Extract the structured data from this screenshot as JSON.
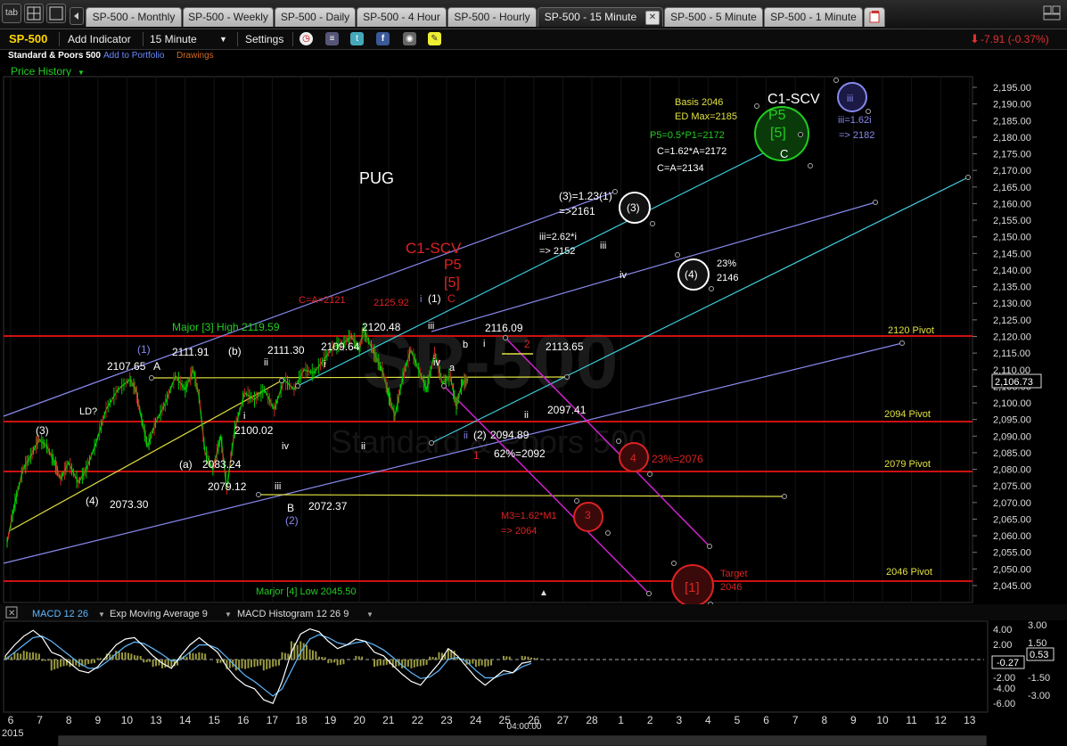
{
  "tabs": [
    {
      "label": "SP-500 - Monthly",
      "active": false
    },
    {
      "label": "SP-500 - Weekly",
      "active": false
    },
    {
      "label": "SP-500 - Daily",
      "active": false
    },
    {
      "label": "SP-500 - 4 Hour",
      "active": false
    },
    {
      "label": "SP-500 - Hourly",
      "active": false
    },
    {
      "label": "SP-500 - 15 Minute",
      "active": true
    },
    {
      "label": "SP-500 - 5 Minute",
      "active": false
    },
    {
      "label": "SP-500 - 1 Minute",
      "active": false
    }
  ],
  "tab_icon_label": "tab",
  "toolbar": {
    "symbol": "SP-500",
    "add_indicator": "Add Indicator",
    "interval": "15 Minute",
    "settings": "Settings",
    "change": "-7.91 (-0.37%)"
  },
  "subheader": {
    "name": "Standard & Poors 500",
    "add_to_portfolio": "Add to Portfolio",
    "drawings": "Drawings",
    "price_history": "Price History"
  },
  "colors": {
    "up": "#00cc00",
    "down": "#cc2222",
    "cyan_line": "#40d0e0",
    "purple_line": "#8888ee",
    "pivot_line": "#cc1111",
    "yellow_line": "#e0e040",
    "magenta_line": "#cc22cc"
  },
  "chart_data": [
    {
      "type": "candlestick",
      "symbol": "SP-500",
      "watermark": "SP-500",
      "watermark_sub": "Standard & Poors 500",
      "ylim": [
        2040,
        2200
      ],
      "y_ticks": [
        "2,195.00",
        "2,190.00",
        "2,185.00",
        "2,180.00",
        "2,175.00",
        "2,170.00",
        "2,165.00",
        "2,160.00",
        "2,155.00",
        "2,150.00",
        "2,145.00",
        "2,140.00",
        "2,135.00",
        "2,130.00",
        "2,125.00",
        "2,120.00",
        "2,115.00",
        "2,110.00",
        "2,105.00",
        "2,100.00",
        "2,095.00",
        "2,090.00",
        "2,085.00",
        "2,080.00",
        "2,075.00",
        "2,070.00",
        "2,065.00",
        "2,060.00",
        "2,055.00",
        "2,050.00",
        "2,045.00"
      ],
      "last_price": "2,106.73",
      "x_ticks": [
        "6",
        "7",
        "8",
        "9",
        "10",
        "13",
        "14",
        "15",
        "16",
        "17",
        "18",
        "19",
        "20",
        "21",
        "22",
        "23",
        "24",
        "25",
        "26",
        "27",
        "28",
        "1",
        "2",
        "3",
        "4",
        "5",
        "6",
        "7",
        "8",
        "9",
        "10",
        "11",
        "12",
        "13",
        "14",
        "15",
        "16",
        "17",
        "18",
        "19",
        "20",
        "21"
      ],
      "year_label": "2015",
      "time_label": "04:00:00",
      "price_path": [
        [
          0,
          2058
        ],
        [
          0.4,
          2070
        ],
        [
          0.8,
          2080
        ],
        [
          1.2,
          2084
        ],
        [
          1.6,
          2089
        ],
        [
          2,
          2087
        ],
        [
          2.4,
          2082
        ],
        [
          2.7,
          2077
        ],
        [
          3.1,
          2082
        ],
        [
          3.6,
          2076
        ],
        [
          4.0,
          2080
        ],
        [
          4.5,
          2088
        ],
        [
          5,
          2098
        ],
        [
          5.6,
          2104
        ],
        [
          6.2,
          2107
        ],
        [
          6.5,
          2104
        ],
        [
          6.8,
          2095
        ],
        [
          7.1,
          2087
        ],
        [
          7.5,
          2094
        ],
        [
          8,
          2100
        ],
        [
          8.5,
          2108
        ],
        [
          9,
          2104
        ],
        [
          9.4,
          2110
        ],
        [
          9.7,
          2102
        ],
        [
          10,
          2085
        ],
        [
          10.4,
          2080
        ],
        [
          10.8,
          2090
        ],
        [
          11.1,
          2074
        ],
        [
          11.5,
          2092
        ],
        [
          12,
          2103
        ],
        [
          12.5,
          2101
        ],
        [
          13,
          2104
        ],
        [
          13.5,
          2098
        ],
        [
          14,
          2107
        ],
        [
          14.5,
          2104
        ],
        [
          15,
          2110
        ],
        [
          15.5,
          2109
        ],
        [
          16,
          2113
        ],
        [
          16.5,
          2117
        ],
        [
          17,
          2118
        ],
        [
          17.4,
          2120
        ],
        [
          17.8,
          2116
        ],
        [
          18,
          2122
        ],
        [
          18.4,
          2117
        ],
        [
          18.7,
          2113
        ],
        [
          19,
          2109
        ],
        [
          19.3,
          2102
        ],
        [
          19.6,
          2096
        ],
        [
          20,
          2108
        ],
        [
          20.4,
          2116
        ],
        [
          20.8,
          2110
        ],
        [
          21.2,
          2104
        ],
        [
          21.6,
          2115
        ],
        [
          22.0,
          2106
        ],
        [
          22.4,
          2108
        ],
        [
          22.7,
          2099
        ],
        [
          23.0,
          2106
        ],
        [
          23.3,
          2107
        ]
      ],
      "pivots": [
        {
          "label": "2120 Pivot",
          "value": 2120
        },
        {
          "label": "2094 Pivot",
          "value": 2094
        },
        {
          "label": "2079 Pivot",
          "value": 2079
        },
        {
          "label": "2046 Pivot",
          "value": 2046
        }
      ],
      "annotations": [
        {
          "text": "PUG",
          "color": "#ffffff"
        },
        {
          "text": "C1-SCV",
          "color": "#dd2222"
        },
        {
          "text": "P5",
          "color": "#dd2222"
        },
        {
          "text": "[5]",
          "color": "#dd2222"
        },
        {
          "text": "C1-SCV",
          "color": "#ffffff"
        },
        {
          "text": "P5",
          "color": "#22cc22"
        },
        {
          "text": "[5]",
          "color": "#22cc22"
        },
        {
          "text": "C",
          "color": "#ffffff"
        },
        {
          "text": "Basis 2046",
          "color": "#e0e040"
        },
        {
          "text": "ED Max=2185",
          "color": "#e0e040"
        },
        {
          "text": "P5=0.5*P1=2172",
          "color": "#22cc22"
        },
        {
          "text": "C=1.62*A=2172",
          "color": "#ffffff"
        },
        {
          "text": "C=A=2134",
          "color": "#ffffff"
        },
        {
          "text": "iii",
          "color": "#8888ee"
        },
        {
          "text": "iii=1.62i",
          "color": "#8888ee"
        },
        {
          "text": "=> 2182",
          "color": "#8888ee"
        },
        {
          "text": "(3)=1.23(1)",
          "color": "#ffffff"
        },
        {
          "text": "=>2161",
          "color": "#ffffff"
        },
        {
          "text": "(3)",
          "color": "#ffffff"
        },
        {
          "text": "iii=2.62*i",
          "color": "#ffffff"
        },
        {
          "text": "=> 2152",
          "color": "#ffffff"
        },
        {
          "text": "iii",
          "color": "#ffffff"
        },
        {
          "text": "iv",
          "color": "#ffffff"
        },
        {
          "text": "(4)",
          "color": "#ffffff"
        },
        {
          "text": "23%",
          "color": "#ffffff"
        },
        {
          "text": "2146",
          "color": "#ffffff"
        },
        {
          "text": "C=A=2121",
          "color": "#dd2222"
        },
        {
          "text": "2125.92",
          "color": "#dd2222"
        },
        {
          "text": "i",
          "color": "#8888ee"
        },
        {
          "text": "(1)",
          "color": "#ffffff"
        },
        {
          "text": "C",
          "color": "#dd2222"
        },
        {
          "text": "Major [3] High 2119.59",
          "color": "#22cc22"
        },
        {
          "text": "2120.48",
          "color": "#ffffff"
        },
        {
          "text": "2116.09",
          "color": "#ffffff"
        },
        {
          "text": "2",
          "color": "#dd2222"
        },
        {
          "text": "2113.65",
          "color": "#ffffff"
        },
        {
          "text": "iii",
          "color": "#ffffff"
        },
        {
          "text": "i",
          "color": "#ffffff"
        },
        {
          "text": "b",
          "color": "#ffffff"
        },
        {
          "text": "iv",
          "color": "#ffffff"
        },
        {
          "text": "a",
          "color": "#ffffff"
        },
        {
          "text": "ii",
          "color": "#ffffff"
        },
        {
          "text": "2097.41",
          "color": "#ffffff"
        },
        {
          "text": "ii",
          "color": "#8888ee"
        },
        {
          "text": "(2)",
          "color": "#ffffff"
        },
        {
          "text": "2094.89",
          "color": "#ffffff"
        },
        {
          "text": "1",
          "color": "#dd2222"
        },
        {
          "text": "62%=2092",
          "color": "#ffffff"
        },
        {
          "text": "4",
          "color": "#dd2222"
        },
        {
          "text": "23%=2076",
          "color": "#dd2222"
        },
        {
          "text": "M3=1.62*M1",
          "color": "#dd2222"
        },
        {
          "text": "=> 2064",
          "color": "#dd2222"
        },
        {
          "text": "3",
          "color": "#dd2222"
        },
        {
          "text": "Target",
          "color": "#dd2222"
        },
        {
          "text": "2046",
          "color": "#dd2222"
        },
        {
          "text": "[1]",
          "color": "#dd2222"
        },
        {
          "text": "Marjor [4] Low 2045.50",
          "color": "#22cc22"
        },
        {
          "text": "(1)",
          "color": "#8888ee"
        },
        {
          "text": "2107.65",
          "color": "#ffffff"
        },
        {
          "text": "A",
          "color": "#ffffff"
        },
        {
          "text": "2111.91",
          "color": "#ffffff"
        },
        {
          "text": "(b)",
          "color": "#ffffff"
        },
        {
          "text": "ii",
          "color": "#ffffff"
        },
        {
          "text": "2111.30",
          "color": "#ffffff"
        },
        {
          "text": "2109.64",
          "color": "#ffffff"
        },
        {
          "text": "i",
          "color": "#ffffff"
        },
        {
          "text": "LD?",
          "color": "#ffffff"
        },
        {
          "text": "(3)",
          "color": "#ffffff"
        },
        {
          "text": "i",
          "color": "#ffffff"
        },
        {
          "text": "2100.02",
          "color": "#ffffff"
        },
        {
          "text": "iv",
          "color": "#ffffff"
        },
        {
          "text": "ii",
          "color": "#ffffff"
        },
        {
          "text": "(a)",
          "color": "#ffffff"
        },
        {
          "text": "2083.24",
          "color": "#ffffff"
        },
        {
          "text": "2079.12",
          "color": "#ffffff"
        },
        {
          "text": "iii",
          "color": "#ffffff"
        },
        {
          "text": "(4)",
          "color": "#ffffff"
        },
        {
          "text": "2073.30",
          "color": "#ffffff"
        },
        {
          "text": "B",
          "color": "#ffffff"
        },
        {
          "text": "(2)",
          "color": "#8888ee"
        },
        {
          "text": "2072.37",
          "color": "#ffffff"
        }
      ]
    },
    {
      "type": "line",
      "title": "MACD 12 26",
      "subtitle": "Exp Moving Average 9",
      "histogram_label": "MACD Histogram 12 26 9",
      "y_ticks_left": [
        "4.00",
        "2.00",
        "-2.00",
        "-4.00",
        "-6.00"
      ],
      "y_ticks_right": [
        "3.00",
        "1.50",
        "-1.50",
        "-3.00"
      ],
      "value_left": "-0.27",
      "value_right": "0.53",
      "series": [
        {
          "name": "MACD 12 26",
          "values": [
            0.5,
            2,
            3.2,
            4,
            3,
            1,
            0.5,
            -0.5,
            -1.5,
            -1.8,
            -1,
            0.5,
            2,
            2.8,
            3,
            1.8,
            0.5,
            -0.5,
            -1.2,
            0.5,
            2,
            3,
            2,
            1,
            -1,
            -2.5,
            -3.5,
            -4,
            -5.5,
            -6,
            -3,
            1,
            3.5,
            4.2,
            3.8,
            2.5,
            1.5,
            2,
            2.8,
            2.5,
            1,
            0.5,
            -0.8,
            -2,
            -3,
            -3.5,
            -2,
            -0.5,
            1.5,
            0.5,
            -1,
            -2.5,
            -3.5,
            -2.5,
            -1.5,
            -1.8,
            -0.5,
            -0.27
          ]
        },
        {
          "name": "Exp Moving Average 9",
          "values": [
            0,
            1,
            2,
            3,
            3.2,
            2.5,
            1.5,
            0.5,
            -0.5,
            -1.2,
            -1.2,
            -0.3,
            0.8,
            1.8,
            2.4,
            2.2,
            1.5,
            0.7,
            -0.2,
            0,
            1,
            2,
            2,
            1.5,
            0.3,
            -1,
            -2.2,
            -3,
            -4,
            -5,
            -4,
            -1.5,
            1,
            2.8,
            3.4,
            3,
            2.3,
            2,
            2.3,
            2.5,
            2,
            1.3,
            0.3,
            -0.8,
            -1.8,
            -2.6,
            -2.4,
            -1.5,
            0,
            0.3,
            -0.3,
            -1.5,
            -2.5,
            -2.5,
            -2,
            -1.8,
            -1,
            -0.53
          ]
        },
        {
          "name": "MACD Histogram 12 26 9",
          "values": [
            0.5,
            1,
            1.2,
            1,
            -0.2,
            -1.5,
            -1,
            -1,
            -1,
            -0.6,
            0.2,
            0.8,
            1.2,
            1,
            0.6,
            -0.4,
            -1,
            -1.2,
            -1,
            0.5,
            1,
            1,
            0,
            -0.5,
            -1.3,
            -1.5,
            -1.3,
            -1,
            -1.5,
            -1,
            1,
            2.5,
            2.5,
            1.4,
            0.4,
            -0.5,
            -0.8,
            0,
            0.5,
            0,
            -1,
            -0.8,
            -1.1,
            -1.2,
            -1.2,
            -0.9,
            0.4,
            1,
            1.5,
            0.2,
            -0.7,
            -1,
            -1,
            0,
            0.5,
            0,
            0.5,
            0.26
          ]
        }
      ]
    }
  ]
}
